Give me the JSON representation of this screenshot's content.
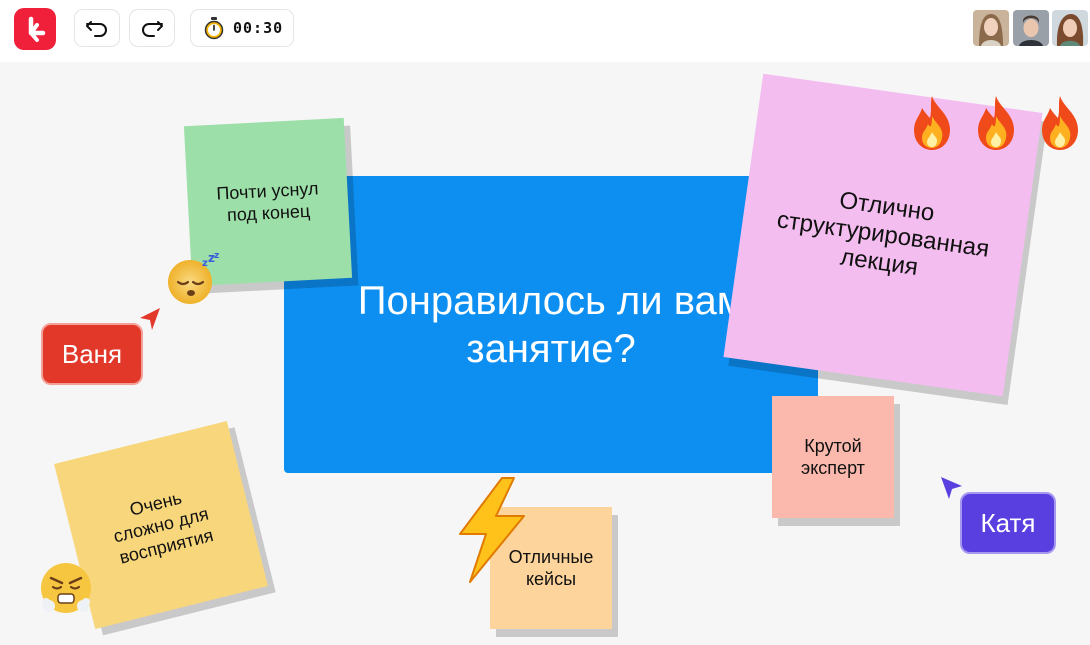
{
  "toolbar": {
    "timer": "00:30"
  },
  "participants": [
    {
      "name": "participant-1"
    },
    {
      "name": "participant-2"
    },
    {
      "name": "participant-3"
    }
  ],
  "board": {
    "question": "Понравилось ли вам занятие?",
    "notes": {
      "almost_slept": "Почти уснул под конец",
      "well_structured": "Отлично структурированная лекция",
      "cool_expert": "Крутой эксперт",
      "great_cases": "Отличные кейсы",
      "hard_to_follow": "Очень сложно для восприятия"
    },
    "users": {
      "vanya": "Ваня",
      "katya": "Катя"
    }
  },
  "colors": {
    "brand": "#f0203a",
    "question_bg": "#0d8ff2",
    "note_green": "#9ddfa8",
    "note_pink": "#f4bdf0",
    "note_salmon": "#fbb9ad",
    "note_peach": "#fdd49b",
    "note_yellow": "#f8d77c",
    "vanya_tag": "#e2382a",
    "katya_tag": "#5a3fe0"
  }
}
